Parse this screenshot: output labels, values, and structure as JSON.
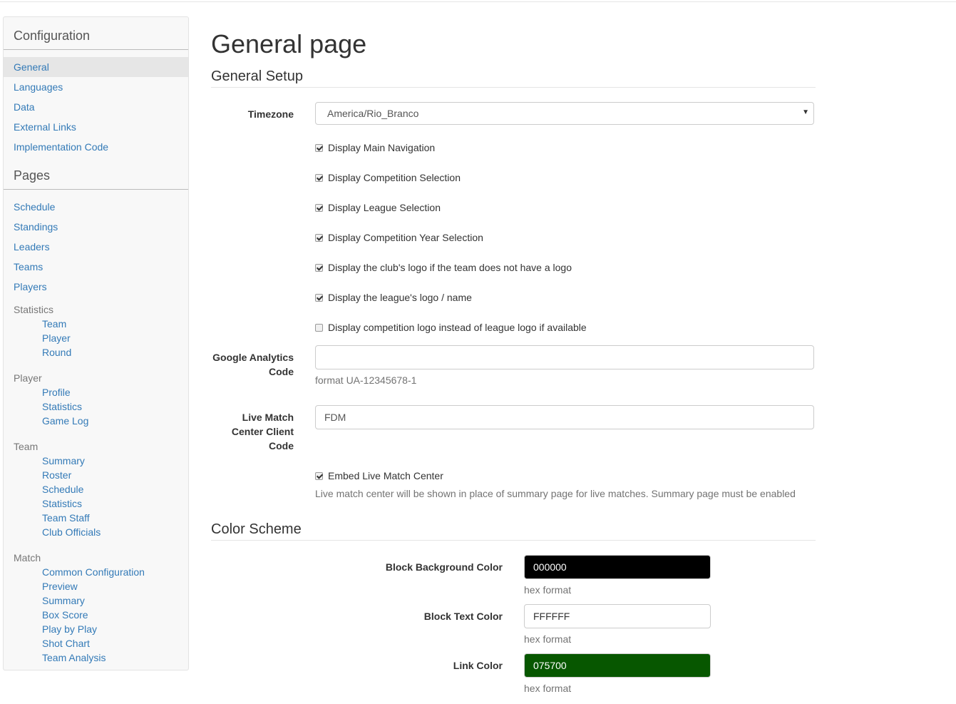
{
  "sidebar": {
    "configuration_heading": "Configuration",
    "config_items": [
      "General",
      "Languages",
      "Data",
      "External Links",
      "Implementation Code"
    ],
    "pages_heading": "Pages",
    "page_items": [
      "Schedule",
      "Standings",
      "Leaders",
      "Teams",
      "Players"
    ],
    "statistics_group": "Statistics",
    "statistics_items": [
      "Team",
      "Player",
      "Round"
    ],
    "player_group": "Player",
    "player_items": [
      "Profile",
      "Statistics",
      "Game Log"
    ],
    "team_group": "Team",
    "team_items": [
      "Summary",
      "Roster",
      "Schedule",
      "Statistics",
      "Team Staff",
      "Club Officials"
    ],
    "match_group": "Match",
    "match_items": [
      "Common Configuration",
      "Preview",
      "Summary",
      "Box Score",
      "Play by Play",
      "Shot Chart",
      "Team Analysis"
    ]
  },
  "main": {
    "page_title": "General page",
    "general_setup_heading": "General Setup",
    "timezone_label": "Timezone",
    "timezone_value": "America/Rio_Branco",
    "checkboxes": [
      {
        "label": "Display Main Navigation",
        "checked": true
      },
      {
        "label": "Display Competition Selection",
        "checked": true
      },
      {
        "label": "Display League Selection",
        "checked": true
      },
      {
        "label": "Display Competition Year Selection",
        "checked": true
      },
      {
        "label": "Display the club's logo if the team does not have a logo",
        "checked": true
      },
      {
        "label": "Display the league's logo / name",
        "checked": true
      },
      {
        "label": "Display competition logo instead of league logo if available",
        "checked": false
      }
    ],
    "ga_label_line1": "Google Analytics",
    "ga_label_line2": "Code",
    "ga_value": "",
    "ga_help": "format UA-12345678-1",
    "lmc_label_line1": "Live Match",
    "lmc_label_line2": "Center Client",
    "lmc_label_line3": "Code",
    "lmc_value": "FDM",
    "embed_label": "Embed Live Match Center",
    "embed_checked": true,
    "embed_help": "Live match center will be shown in place of summary page for live matches. Summary page must be enabled",
    "color_scheme_heading": "Color Scheme",
    "colors": [
      {
        "label": "Block Background Color",
        "value": "000000",
        "bg": "#000000",
        "fg": "#ffffff",
        "help": "hex format"
      },
      {
        "label": "Block Text Color",
        "value": "FFFFFF",
        "bg": "#ffffff",
        "fg": "#333333",
        "help": "hex format"
      },
      {
        "label": "Link Color",
        "value": "075700",
        "bg": "#075700",
        "fg": "#ffffff",
        "help": "hex format"
      }
    ]
  }
}
